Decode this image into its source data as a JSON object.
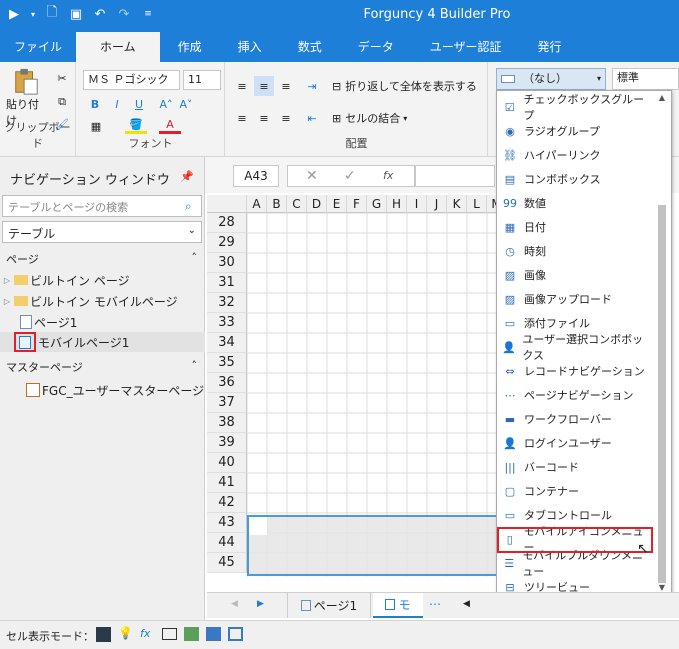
{
  "app_title": "Forguncy 4 Builder Pro",
  "ribbon_tabs": [
    "ファイル",
    "ホーム",
    "作成",
    "挿入",
    "数式",
    "データ",
    "ユーザー認証",
    "発行"
  ],
  "clipboard": {
    "paste_label": "貼り付け",
    "group_label": "クリップボード"
  },
  "font": {
    "font_name": "ＭＳ Ｐゴシック",
    "font_size": "11",
    "group_label": "フォント"
  },
  "alignment": {
    "wrap_label": "折り返して全体を表示する",
    "merge_label": "セルの結合",
    "group_label": "配置"
  },
  "cell_type_combo": "（なし）",
  "style_combo": "標準",
  "nav": {
    "title": "ナビゲーション ウィンドウ",
    "search_placeholder": "テーブルとページの検索",
    "select_value": "テーブル",
    "pages_header": "ページ",
    "pages": [
      "ビルトイン ページ",
      "ビルトイン モバイルページ",
      "ページ1",
      "モバイルページ1"
    ],
    "master_header": "マスターページ",
    "master_pages": [
      "FGC_ユーザーマスターページ"
    ]
  },
  "formula": {
    "cell_ref": "A43",
    "fx": "fx"
  },
  "grid": {
    "columns": [
      "A",
      "B",
      "C",
      "D",
      "E",
      "F",
      "G",
      "H",
      "I",
      "J",
      "K",
      "L",
      "M"
    ],
    "rows": [
      "28",
      "29",
      "30",
      "31",
      "32",
      "33",
      "34",
      "35",
      "36",
      "37",
      "38",
      "39",
      "40",
      "41",
      "42",
      "43",
      "44",
      "45"
    ]
  },
  "cell_types": [
    {
      "label": "チェックボックスグループ",
      "icon": "checkbox-group-icon"
    },
    {
      "label": "ラジオグループ",
      "icon": "radio-group-icon"
    },
    {
      "label": "ハイパーリンク",
      "icon": "hyperlink-icon"
    },
    {
      "label": "コンボボックス",
      "icon": "combobox-icon"
    },
    {
      "label": "数値",
      "icon": "number-icon"
    },
    {
      "label": "日付",
      "icon": "date-icon"
    },
    {
      "label": "時刻",
      "icon": "time-icon"
    },
    {
      "label": "画像",
      "icon": "image-icon"
    },
    {
      "label": "画像アップロード",
      "icon": "image-upload-icon"
    },
    {
      "label": "添付ファイル",
      "icon": "attachment-icon"
    },
    {
      "label": "ユーザー選択コンボボックス",
      "icon": "user-select-icon"
    },
    {
      "label": "レコードナビゲーション",
      "icon": "record-nav-icon"
    },
    {
      "label": "ページナビゲーション",
      "icon": "page-nav-icon"
    },
    {
      "label": "ワークフローバー",
      "icon": "workflow-bar-icon"
    },
    {
      "label": "ログインユーザー",
      "icon": "login-user-icon"
    },
    {
      "label": "バーコード",
      "icon": "barcode-icon"
    },
    {
      "label": "コンテナー",
      "icon": "container-icon"
    },
    {
      "label": "タブコントロール",
      "icon": "tab-control-icon"
    },
    {
      "label": "モバイルアイコンメニュー",
      "icon": "mobile-icon-menu-icon"
    },
    {
      "label": "モバイルプルダウンメニュー",
      "icon": "mobile-pulldown-menu-icon"
    },
    {
      "label": "ツリービュー",
      "icon": "treeview-icon"
    }
  ],
  "sheet_tabs": [
    "ページ1",
    "モ"
  ],
  "status": {
    "mode_label": "セル表示モード："
  },
  "colors": {
    "accent": "#1e7fd8",
    "highlight": "#e0202b",
    "selection": "#2a8ad4"
  }
}
